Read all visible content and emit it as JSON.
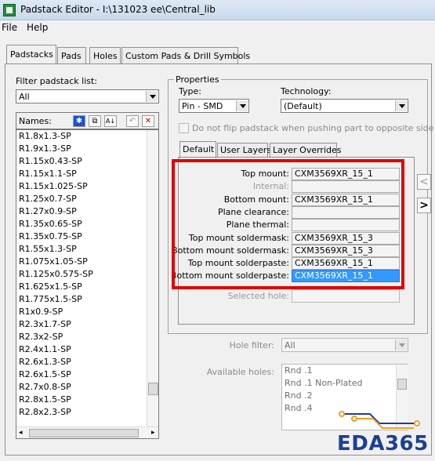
{
  "window": {
    "title": "Padstack Editor - I:\\131023 ee\\Central_lib",
    "icon": "padstack-app-icon"
  },
  "menubar": {
    "file": "File",
    "help": "Help"
  },
  "tabs": [
    {
      "label": "Padstacks"
    },
    {
      "label": "Pads"
    },
    {
      "label": "Holes"
    },
    {
      "label": "Custom Pads & Drill Symbols"
    }
  ],
  "left": {
    "filter_label": "Filter padstack list:",
    "filter_value": "All",
    "names_label": "Names:",
    "toolbar_icons": [
      "new-padstack-icon",
      "copy-padstack-icon",
      "sort-az-icon",
      "undo-icon",
      "delete-icon"
    ],
    "padstacks": [
      "R1.8x1.3-SP",
      "R1.9x1.3-SP",
      "R1.15x0.43-SP",
      "R1.15x1.1-SP",
      "R1.15x1.025-SP",
      "R1.25x0.7-SP",
      "R1.27x0.9-SP",
      "R1.35x0.65-SP",
      "R1.35x0.75-SP",
      "R1.55x1.3-SP",
      "R1.075x1.05-SP",
      "R1.125x0.575-SP",
      "R1.625x1.5-SP",
      "R1.775x1.5-SP",
      "R1x0.9-SP",
      "R2.3x1.7-SP",
      "R2.3x2-SP",
      "R2.4x1.1-SP",
      "R2.6x1.3-SP",
      "R2.6x1.5-SP",
      "R2.7x0.8-SP",
      "R2.8x1.5-SP",
      "R2.8x2.3-SP"
    ]
  },
  "properties": {
    "title": "Properties",
    "type_label": "Type:",
    "type_value": "Pin - SMD",
    "technology_label": "Technology:",
    "technology_value": "(Default)",
    "noflip_label": "Do not flip padstack when pushing part to opposite side",
    "subtabs": [
      {
        "label": "Default"
      },
      {
        "label": "User Layers"
      },
      {
        "label": "Layer Overrides"
      }
    ],
    "rows": [
      {
        "label": "Top mount:",
        "value": "CXM3569XR_15_1"
      },
      {
        "label": "Internal:",
        "value": ""
      },
      {
        "label": "Bottom mount:",
        "value": "CXM3569XR_15_1"
      },
      {
        "label": "Plane clearance:",
        "value": ""
      },
      {
        "label": "Plane thermal:",
        "value": ""
      },
      {
        "label": "Top mount soldermask:",
        "value": "CXM3569XR_15_3"
      },
      {
        "label": "Bottom mount soldermask:",
        "value": "CXM3569XR_15_3"
      },
      {
        "label": "Top mount solderpaste:",
        "value": "CXM3569XR_15_1"
      },
      {
        "label": "Bottom mount solderpaste:",
        "value": "CXM3569XR_15_1"
      }
    ],
    "selected_hole_label": "Selected hole:",
    "nav_prev": "<",
    "nav_next": ">"
  },
  "holes": {
    "hole_filter_label": "Hole filter:",
    "hole_filter_value": "All",
    "available_label": "Available holes:",
    "available": [
      "Rnd .1",
      "Rnd .1 Non-Plated",
      "Rnd .2",
      "Rnd .4"
    ]
  },
  "watermark": {
    "text": "EDA365"
  },
  "colors": {
    "selection": "#3399ff",
    "highlight_box": "#e00000",
    "logo": "#1c3f94"
  }
}
